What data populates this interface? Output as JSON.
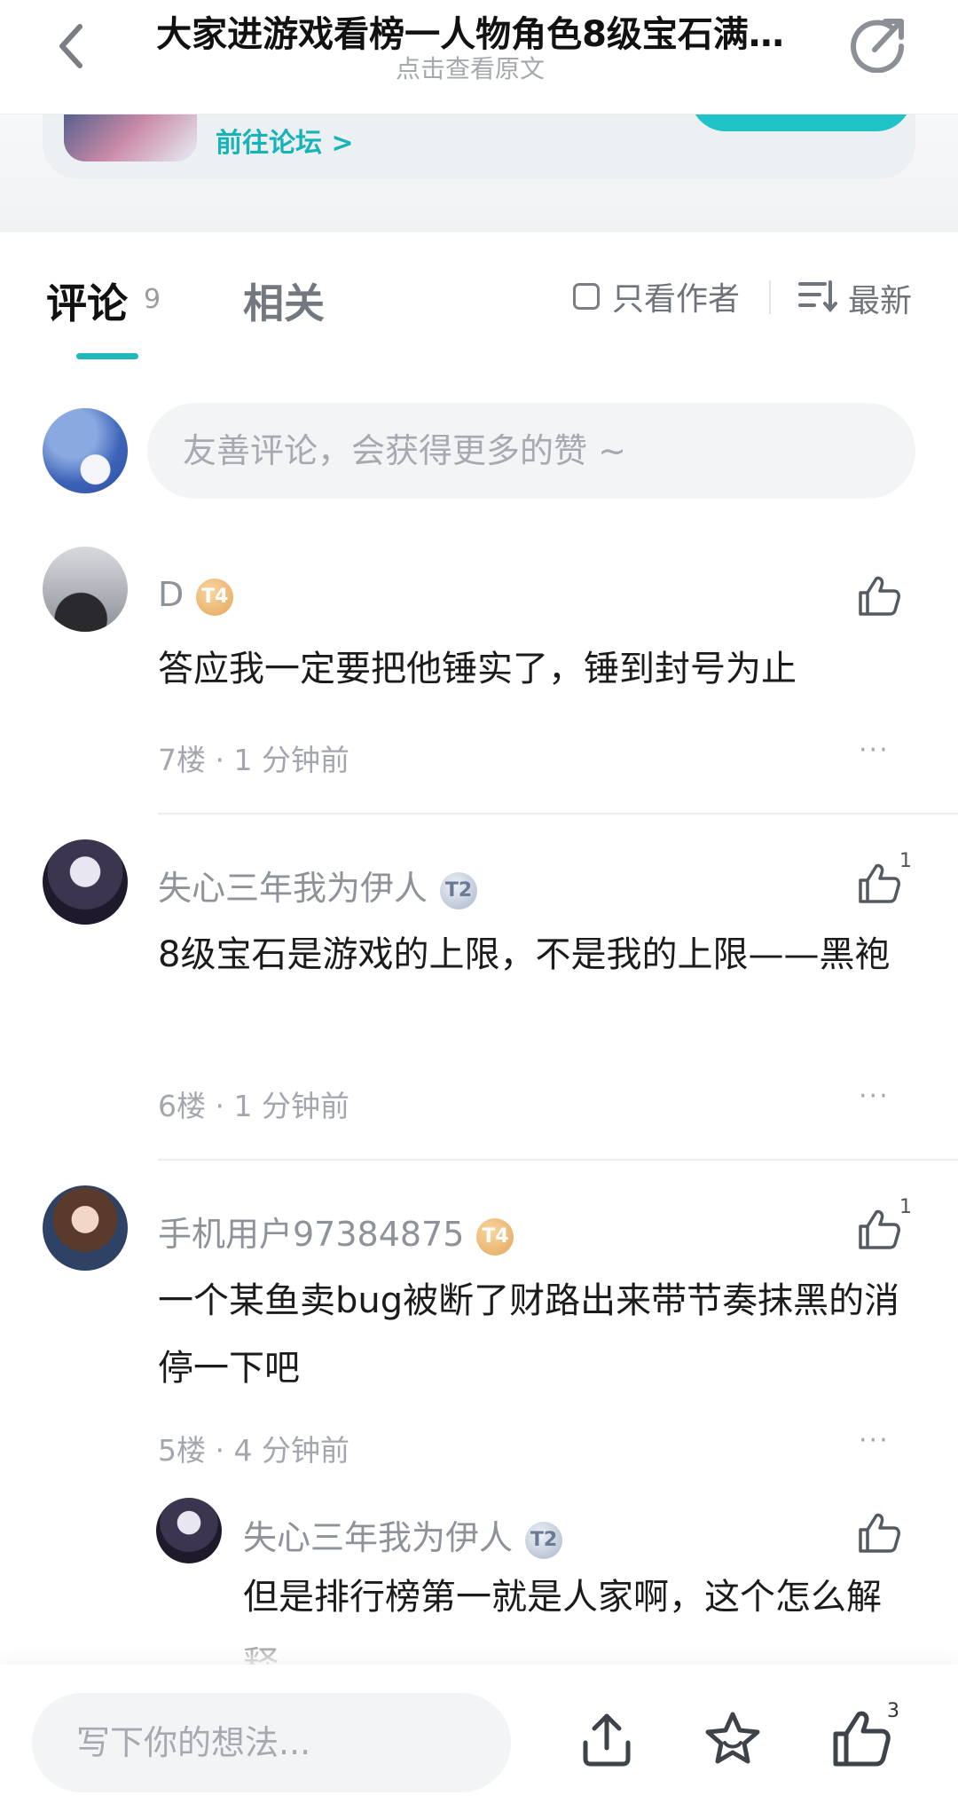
{
  "header": {
    "title": "大家进游戏看榜一人物角色8级宝石满…",
    "subtitle": "点击查看原文"
  },
  "forum": {
    "link_label": "前往论坛 >"
  },
  "tabs": {
    "comments_label": "评论",
    "comments_count": "9",
    "related_label": "相关",
    "author_only_label": "只看作者",
    "sort_label": "最新"
  },
  "composer": {
    "placeholder": "友善评论，会获得更多的赞 ~"
  },
  "comments": [
    {
      "username": "D",
      "badge": "T4",
      "text": "答应我一定要把他锤实了，锤到封号为止",
      "floor": "7楼",
      "time": "1 分钟前",
      "likes": ""
    },
    {
      "username": "失心三年我为伊人",
      "badge": "T2",
      "text": "8级宝石是游戏的上限，不是我的上限——黑袍",
      "floor": "6楼",
      "time": "1 分钟前",
      "likes": "1"
    },
    {
      "username": "手机用户97384875",
      "badge": "T4",
      "text": "一个某鱼卖bug被断了财路出来带节奏抹黑的消停一下吧",
      "floor": "5楼",
      "time": "4 分钟前",
      "likes": "1",
      "reply": {
        "username": "失心三年我为伊人",
        "badge": "T2",
        "text": "但是排行榜第一就是人家啊，这个怎么解释"
      }
    }
  ],
  "meta_separator": "·",
  "more_label": "···",
  "bottom_bar": {
    "placeholder": "写下你的想法...",
    "like_count": "3"
  },
  "icons": {
    "back": "back-arrow-icon",
    "share": "share-icon",
    "like": "thumbs-up-icon",
    "upload": "upload-share-icon",
    "favorite": "star-icon"
  },
  "colors": {
    "accent": "#1fb8bd",
    "muted_text": "#a3a7ad",
    "gold_badge": "#e4a55b",
    "silver_badge": "#a9b5c8"
  }
}
